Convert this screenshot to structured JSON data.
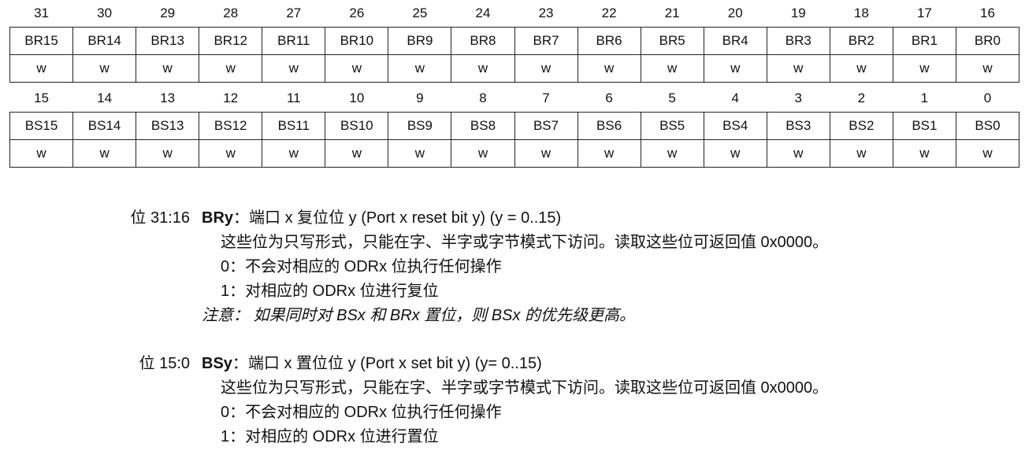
{
  "register": {
    "high_bits": [
      "31",
      "30",
      "29",
      "28",
      "27",
      "26",
      "25",
      "24",
      "23",
      "22",
      "21",
      "20",
      "19",
      "18",
      "17",
      "16"
    ],
    "high_names": [
      "BR15",
      "BR14",
      "BR13",
      "BR12",
      "BR11",
      "BR10",
      "BR9",
      "BR8",
      "BR7",
      "BR6",
      "BR5",
      "BR4",
      "BR3",
      "BR2",
      "BR1",
      "BR0"
    ],
    "low_bits": [
      "15",
      "14",
      "13",
      "12",
      "11",
      "10",
      "9",
      "8",
      "7",
      "6",
      "5",
      "4",
      "3",
      "2",
      "1",
      "0"
    ],
    "low_names": [
      "BS15",
      "BS14",
      "BS13",
      "BS12",
      "BS11",
      "BS10",
      "BS9",
      "BS8",
      "BS7",
      "BS6",
      "BS5",
      "BS4",
      "BS3",
      "BS2",
      "BS1",
      "BS0"
    ],
    "access": "w"
  },
  "fields": [
    {
      "bits_label": "位 31:16",
      "name": "BRy",
      "title": "：端口 x 复位位 y (Port x reset bit y) (y = 0..15)",
      "desc": "这些位为只写形式，只能在字、半字或字节模式下访问。读取这些位可返回值 0x0000。",
      "opt0": "0：不会对相应的 ODRx 位执行任何操作",
      "opt1": "1：对相应的 ODRx 位进行复位",
      "note": "注意：  如果同时对 BSx 和 BRx 置位，则 BSx 的优先级更高。"
    },
    {
      "bits_label": "位 15:0",
      "name": "BSy",
      "title": "：端口 x 置位位 y (Port x set bit y) (y= 0..15)",
      "desc": "这些位为只写形式，只能在字、半字或字节模式下访问。读取这些位可返回值 0x0000。",
      "opt0": "0：不会对相应的 ODRx 位执行任何操作",
      "opt1": "1：对相应的 ODRx 位进行置位"
    }
  ]
}
